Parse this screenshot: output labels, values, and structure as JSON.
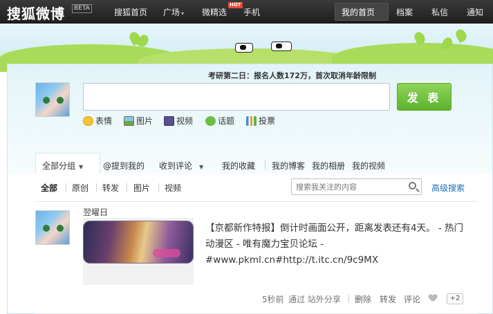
{
  "nav": {
    "logo": "搜狐微博",
    "beta": "BETA",
    "items": [
      {
        "label": "搜狐首页"
      },
      {
        "label": "广场"
      },
      {
        "label": "微精选"
      },
      {
        "label": "手机"
      }
    ],
    "hot_badge": "HOT",
    "right_items": [
      {
        "label": "我的首页"
      },
      {
        "label": "档案"
      },
      {
        "label": "私信"
      },
      {
        "label": "通知"
      }
    ]
  },
  "composer": {
    "headline": "考研第二日：报名人数172万，首次取消年龄限制",
    "input_value": "",
    "publish_label": "发 表",
    "tools": [
      {
        "label": "表情",
        "icon": "smile-icon"
      },
      {
        "label": "图片",
        "icon": "picture-icon"
      },
      {
        "label": "视频",
        "icon": "video-icon"
      },
      {
        "label": "话题",
        "icon": "topic-icon"
      },
      {
        "label": "投票",
        "icon": "vote-icon"
      }
    ]
  },
  "tabs": {
    "all_groups": "全部分组",
    "mentions": "@提到我的",
    "comments": "收到评论",
    "favorites": "我的收藏",
    "blog": "我的博客",
    "album": "我的相册",
    "videos": "我的视频"
  },
  "filters": {
    "items": [
      "全部",
      "原创",
      "转发",
      "图片",
      "视频"
    ],
    "search_placeholder": "搜索我关注的内容",
    "advanced_search": "高级搜索"
  },
  "feed": {
    "author": "翌曜日",
    "text": "【京都新作特报】倒计时画面公开，距离发表还有4天。 - 热门动漫区 - 唯有魔力宝贝论坛 - #www.pkml.cn#http://t.itc.cn/9c9MX",
    "time": "5秒前",
    "via": "通过 站外分享",
    "delete": "删除",
    "repost": "转发",
    "comment": "评论",
    "plus": "+2"
  },
  "colors": {
    "topbar": "#2a2a2a",
    "publish_green": "#6cbf3c",
    "link_blue": "#1a6fb8"
  }
}
